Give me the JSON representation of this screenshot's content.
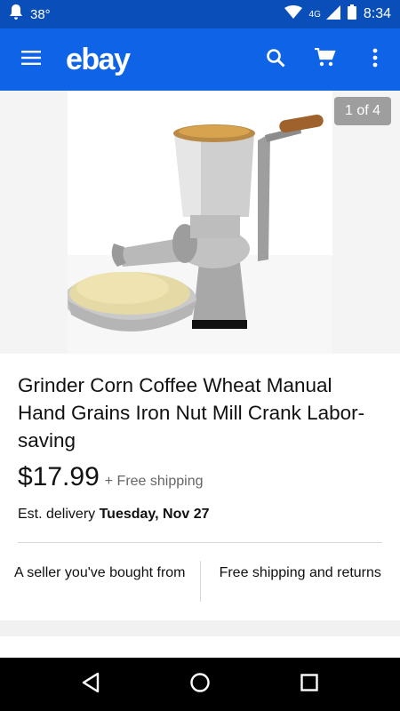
{
  "status_bar": {
    "temperature": "38°",
    "network": "4G",
    "time": "8:34",
    "icons": [
      "notification-icon",
      "wifi-icon",
      "signal-icon",
      "battery-icon"
    ]
  },
  "app_bar": {
    "logo": "ebay",
    "icons": [
      "menu-icon",
      "search-icon",
      "cart-icon",
      "more-vert-icon"
    ]
  },
  "gallery": {
    "counter": "1 of 4"
  },
  "item": {
    "title": "Grinder Corn Coffee Wheat Manual Hand Grains Iron Nut Mill Crank Labor-saving",
    "price": "$17.99",
    "shipping": "+ Free shipping",
    "delivery_label": "Est. delivery",
    "delivery_date": "Tuesday, Nov 27",
    "perks": [
      "A seller you've bought from",
      "Free shipping and returns"
    ]
  },
  "colors": {
    "status_bar": "#0a4fb9",
    "app_bar": "#0f63e6"
  }
}
